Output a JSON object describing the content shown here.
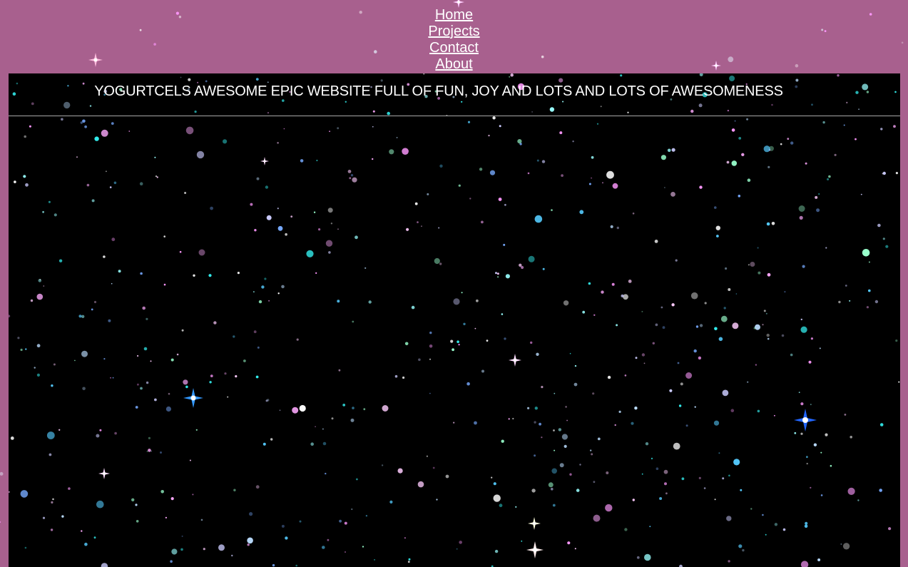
{
  "nav": {
    "links": [
      {
        "label": "Home"
      },
      {
        "label": "Projects"
      },
      {
        "label": "Contact"
      },
      {
        "label": "About"
      }
    ]
  },
  "header": {
    "title": "YOGURTCELS AWESOME EPIC WEBSITE FULL OF FUN, JOY AND LOTS AND LOTS OF AWESOMENESS"
  },
  "colors": {
    "page_background": "#a8608e",
    "content_background": "#000000",
    "text": "#ffffff",
    "divider": "#a9a9a9"
  }
}
